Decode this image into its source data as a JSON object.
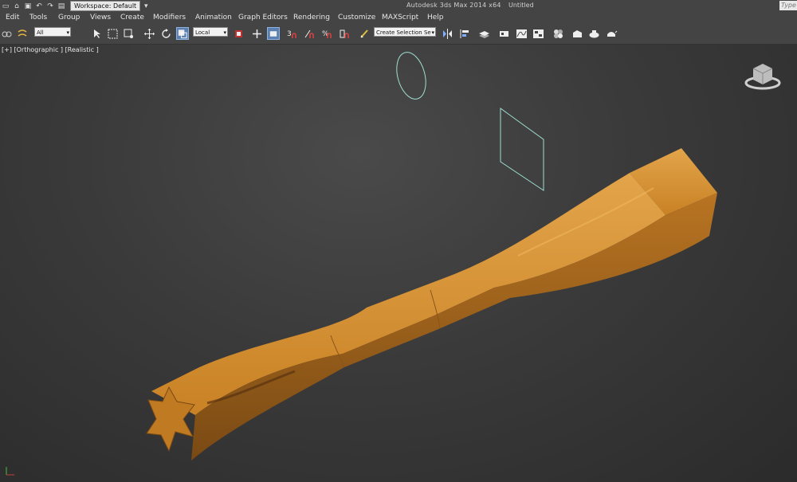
{
  "app": {
    "title": "Autodesk 3ds Max  2014 x64",
    "document": "Untitled",
    "workspace": "Workspace: Default",
    "search_placeholder": "Type"
  },
  "menu": [
    "Edit",
    "Tools",
    "Group",
    "Views",
    "Create",
    "Modifiers",
    "Animation",
    "Graph Editors",
    "Rendering",
    "Customize",
    "MAXScript",
    "Help"
  ],
  "toolbar": {
    "selection_filter": "All",
    "ref_coord": "Local",
    "named_selection": "Create Selection Se"
  },
  "viewport": {
    "label": "[+] [Orthographic ] [Realistic ]"
  },
  "colors": {
    "ui_bg": "#444444",
    "object": "#d08a30",
    "wire": "#9fe0d0",
    "active_tool": "#5a7fb0"
  }
}
